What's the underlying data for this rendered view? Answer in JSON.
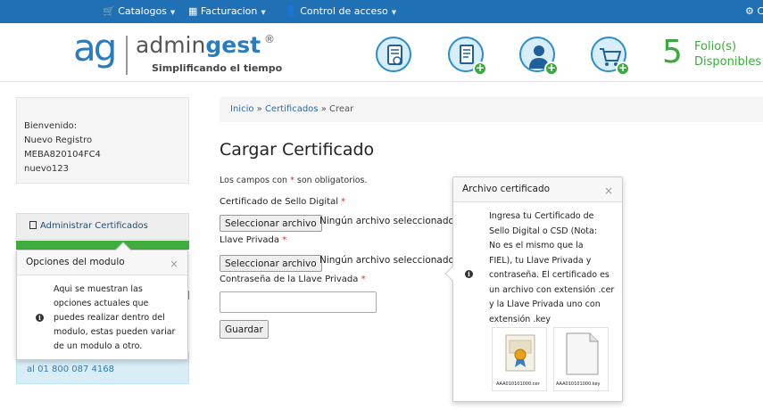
{
  "topnav": {
    "catalogos": "Catalogos",
    "facturacion": "Facturacion",
    "control_acceso": "Control de acceso",
    "right_edge": "C"
  },
  "brand": {
    "logo_mark": "ag",
    "name_part1": "admin",
    "name_part2": "gest",
    "registered": "®",
    "tagline": "Simplificando el tiempo"
  },
  "header_icons": [
    {
      "name": "certificate-document-icon"
    },
    {
      "name": "add-invoice-icon"
    },
    {
      "name": "add-user-icon"
    },
    {
      "name": "add-cart-icon"
    }
  ],
  "folios": {
    "count": "5",
    "label_line1": "Folio(s)",
    "label_line2": "Disponibles"
  },
  "sidebar": {
    "welcome": "Bienvenido:",
    "user_name": "Nuevo Registro",
    "rfc": "MEBA820104FC4",
    "username": "nuevo123",
    "menu_item": "Administrar Certificados",
    "phone": "al 01 800 087 4168"
  },
  "popover_module": {
    "title": "Opciones del modulo",
    "close": "×",
    "lines": [
      "Aqui se muestran las",
      "opciones actuales que",
      "puedes realizar dentro del",
      "modulo, estas pueden variar",
      "de un modulo a otro."
    ]
  },
  "breadcrumb": {
    "inicio": "Inicio",
    "sep1": "»",
    "certificados": "Certificados",
    "sep2": "»",
    "crear": "Crear"
  },
  "form": {
    "title": "Cargar Certificado",
    "required_pre": "Los campos con ",
    "required_star": "*",
    "required_post": " son obligatorios.",
    "csd_label": "Certificado de Sello Digital",
    "csd_button": "Seleccionar archivo",
    "csd_file": "Ningún archivo seleccionado",
    "key_label": "Llave Privada",
    "key_button": "Seleccionar archivo",
    "key_file": "Ningún archivo seleccionado",
    "password_label": "Contraseña de la Llave Privada",
    "password_value": "",
    "save_button": "Guardar",
    "star": "*"
  },
  "popover_file": {
    "title": "Archivo certificado",
    "close": "×",
    "lines": [
      "Ingresa tu Certificado de",
      "Sello Digital o CSD (Nota:",
      "No es el mismo que la",
      "FIEL), tu Llave Privada y",
      "contraseña. El certificado es",
      "un archivo con extensión .cer",
      "y la Llave Privada uno con",
      "extensión .key"
    ],
    "example_cer": "AAA010101000.cer",
    "example_key": "AAA010101000.key"
  },
  "colors": {
    "topbar": "#1f70b5",
    "brand_blue": "#2a7cc0",
    "green": "#3aab3a"
  }
}
